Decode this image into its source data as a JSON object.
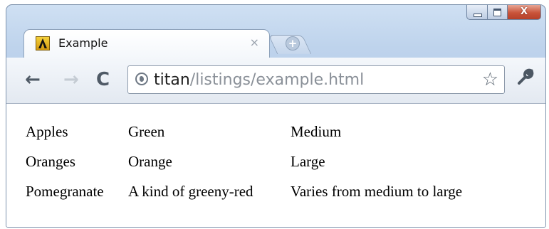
{
  "browser": {
    "tab": {
      "title": "Example",
      "favicon": "letter-a-favicon",
      "close_label": "×"
    },
    "new_tab_label": "+",
    "window_controls": {
      "close_label": "X"
    },
    "toolbar": {
      "back_icon": "←",
      "forward_icon": "→",
      "reload_icon": "C",
      "url_host": "titan",
      "url_path": "/listings/example.html",
      "star_icon": "☆",
      "wrench_icon": "🔧"
    }
  },
  "page": {
    "table": {
      "rows": [
        {
          "name": "Apples",
          "color": "Green",
          "size": "Medium"
        },
        {
          "name": "Oranges",
          "color": "Orange",
          "size": "Large"
        },
        {
          "name": "Pomegranate",
          "color": "A kind of greeny-red",
          "size": "Varies from medium to large"
        }
      ]
    }
  }
}
